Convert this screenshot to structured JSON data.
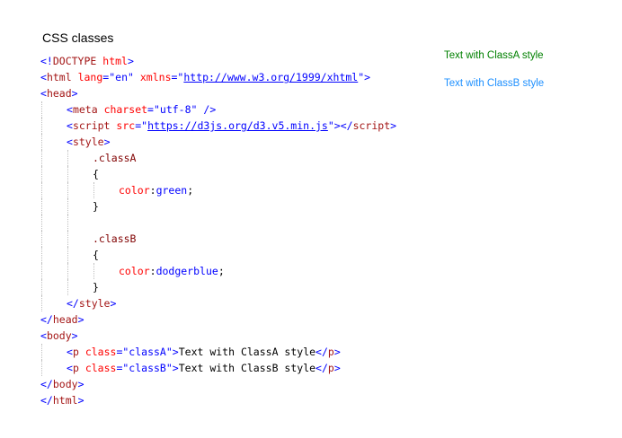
{
  "heading": "CSS classes",
  "colors": {
    "bracket": "#0000ff",
    "tag": "#a31515",
    "attribute": "#ff0000",
    "value": "#0000ff",
    "text": "#000000",
    "classA": "#008000",
    "classB": "#1e90ff"
  },
  "code_lines": [
    {
      "indent": 0,
      "tokens": [
        [
          "br",
          "<!"
        ],
        [
          "tag",
          "DOCTYPE"
        ],
        [
          "txt",
          " "
        ],
        [
          "att",
          "html"
        ],
        [
          "br",
          ">"
        ]
      ]
    },
    {
      "indent": 0,
      "tokens": [
        [
          "br",
          "<"
        ],
        [
          "tag",
          "html"
        ],
        [
          "txt",
          " "
        ],
        [
          "att",
          "lang"
        ],
        [
          "br",
          "=\""
        ],
        [
          "val",
          "en"
        ],
        [
          "br",
          "\""
        ],
        [
          "txt",
          " "
        ],
        [
          "att",
          "xmlns"
        ],
        [
          "br",
          "=\""
        ],
        [
          "url",
          "http://www.w3.org/1999/xhtml"
        ],
        [
          "br",
          "\""
        ],
        [
          "br",
          ">"
        ]
      ]
    },
    {
      "indent": 0,
      "tokens": [
        [
          "br",
          "<"
        ],
        [
          "tag",
          "head"
        ],
        [
          "br",
          ">"
        ]
      ]
    },
    {
      "indent": 1,
      "tokens": [
        [
          "br",
          "<"
        ],
        [
          "tag",
          "meta"
        ],
        [
          "txt",
          " "
        ],
        [
          "att",
          "charset"
        ],
        [
          "br",
          "=\""
        ],
        [
          "val",
          "utf-8"
        ],
        [
          "br",
          "\""
        ],
        [
          "txt",
          " "
        ],
        [
          "br",
          "/>"
        ]
      ]
    },
    {
      "indent": 1,
      "tokens": [
        [
          "br",
          "<"
        ],
        [
          "tag",
          "script"
        ],
        [
          "txt",
          " "
        ],
        [
          "att",
          "src"
        ],
        [
          "br",
          "=\""
        ],
        [
          "url",
          "https://d3js.org/d3.v5.min.js"
        ],
        [
          "br",
          "\""
        ],
        [
          "br",
          "></"
        ],
        [
          "tag",
          "script"
        ],
        [
          "br",
          ">"
        ]
      ]
    },
    {
      "indent": 1,
      "tokens": [
        [
          "br",
          "<"
        ],
        [
          "tag",
          "style"
        ],
        [
          "br",
          ">"
        ]
      ]
    },
    {
      "indent": 2,
      "tokens": [
        [
          "sel",
          ".classA"
        ]
      ]
    },
    {
      "indent": 2,
      "tokens": [
        [
          "txt",
          "{"
        ]
      ]
    },
    {
      "indent": 3,
      "tokens": [
        [
          "att",
          "color"
        ],
        [
          "txt",
          ":"
        ],
        [
          "val",
          "green"
        ],
        [
          "txt",
          ";"
        ]
      ]
    },
    {
      "indent": 2,
      "tokens": [
        [
          "txt",
          "}"
        ]
      ]
    },
    {
      "indent": 2,
      "tokens": []
    },
    {
      "indent": 2,
      "tokens": [
        [
          "sel",
          ".classB"
        ]
      ]
    },
    {
      "indent": 2,
      "tokens": [
        [
          "txt",
          "{"
        ]
      ]
    },
    {
      "indent": 3,
      "tokens": [
        [
          "att",
          "color"
        ],
        [
          "txt",
          ":"
        ],
        [
          "val",
          "dodgerblue"
        ],
        [
          "txt",
          ";"
        ]
      ]
    },
    {
      "indent": 2,
      "tokens": [
        [
          "txt",
          "}"
        ]
      ]
    },
    {
      "indent": 1,
      "tokens": [
        [
          "br",
          "</"
        ],
        [
          "tag",
          "style"
        ],
        [
          "br",
          ">"
        ]
      ]
    },
    {
      "indent": 0,
      "tokens": [
        [
          "br",
          "</"
        ],
        [
          "tag",
          "head"
        ],
        [
          "br",
          ">"
        ]
      ]
    },
    {
      "indent": 0,
      "tokens": [
        [
          "br",
          "<"
        ],
        [
          "tag",
          "body"
        ],
        [
          "br",
          ">"
        ]
      ]
    },
    {
      "indent": 1,
      "tokens": [
        [
          "br",
          "<"
        ],
        [
          "tag",
          "p"
        ],
        [
          "txt",
          " "
        ],
        [
          "att",
          "class"
        ],
        [
          "br",
          "=\""
        ],
        [
          "val",
          "classA"
        ],
        [
          "br",
          "\""
        ],
        [
          "br",
          ">"
        ],
        [
          "txt",
          "Text with ClassA style"
        ],
        [
          "br",
          "</"
        ],
        [
          "tag",
          "p"
        ],
        [
          "br",
          ">"
        ]
      ]
    },
    {
      "indent": 1,
      "tokens": [
        [
          "br",
          "<"
        ],
        [
          "tag",
          "p"
        ],
        [
          "txt",
          " "
        ],
        [
          "att",
          "class"
        ],
        [
          "br",
          "=\""
        ],
        [
          "val",
          "classB"
        ],
        [
          "br",
          "\""
        ],
        [
          "br",
          ">"
        ],
        [
          "txt",
          "Text with ClassB style"
        ],
        [
          "br",
          "</"
        ],
        [
          "tag",
          "p"
        ],
        [
          "br",
          ">"
        ]
      ]
    },
    {
      "indent": 0,
      "tokens": [
        [
          "br",
          "</"
        ],
        [
          "tag",
          "body"
        ],
        [
          "br",
          ">"
        ]
      ]
    },
    {
      "indent": 0,
      "tokens": [
        [
          "br",
          "</"
        ],
        [
          "tag",
          "html"
        ],
        [
          "br",
          ">"
        ]
      ]
    }
  ],
  "preview": {
    "classA_text": "Text with ClassA style",
    "classB_text": "Text with ClassB style"
  }
}
